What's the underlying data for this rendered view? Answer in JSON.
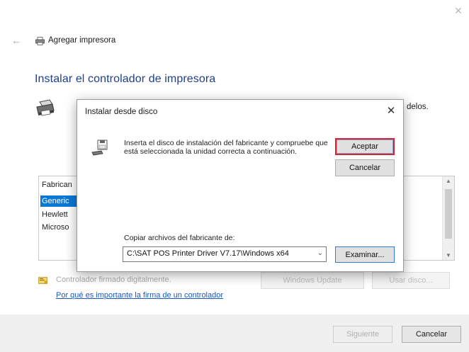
{
  "wizard": {
    "title": "Agregar impresora",
    "heading": "Instalar el controlador de impresora",
    "description_tail": "delos.",
    "list": {
      "header": "Fabrican",
      "rows": [
        "Generic",
        "Hewlett",
        "Microso"
      ]
    },
    "signed_label": "Controlador firmado digitalmente.",
    "why_link": "Por qué es importante la firma de un controlador",
    "windows_update_label": "Windows Update",
    "have_disk_label": "Usar disco...",
    "next_label": "Siguiente",
    "cancel_label": "Cancelar"
  },
  "dialog": {
    "title": "Instalar desde disco",
    "close_glyph": "✕",
    "message": "Inserta el disco de instalación del fabricante y compruebe que está seleccionada la unidad correcta a continuación.",
    "accept_label": "Aceptar",
    "cancel_label": "Cancelar",
    "copy_label": "Copiar archivos del fabricante de:",
    "path_value": "C:\\SAT POS Printer Driver V7.17\\Windows x64",
    "browse_label": "Examinar..."
  },
  "glyphs": {
    "window_close": "✕",
    "back_arrow": "←",
    "chevron_down": "⌄",
    "scroll_up": "▲",
    "scroll_down": "▼"
  },
  "colors": {
    "heading": "#1f3f8a",
    "selection": "#0a78d7",
    "accept_highlight": "#d9242b",
    "link": "#1b57c4"
  }
}
